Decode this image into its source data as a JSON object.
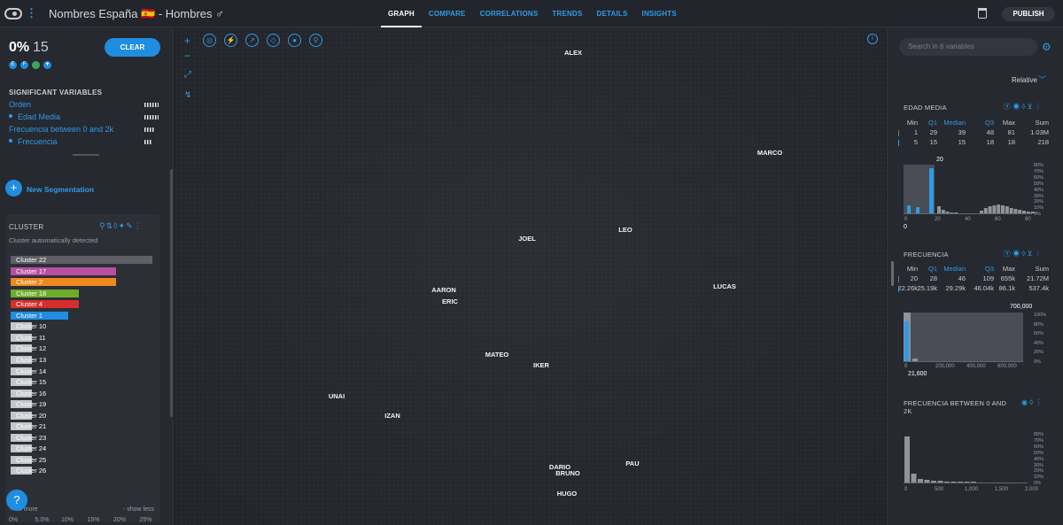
{
  "app": {
    "title": "Nombres España 🇪🇸 - Hombres ♂"
  },
  "tabs": [
    "GRAPH",
    "COMPARE",
    "CORRELATIONS",
    "TRENDS",
    "DETAILS",
    "INSIGHTS"
  ],
  "active_tab": "GRAPH",
  "publish_label": "PUBLISH",
  "selection": {
    "percent": "0%",
    "count": "15",
    "clear_label": "CLEAR"
  },
  "significant": {
    "title": "SIGNIFICANT VARIABLES",
    "items": [
      "Orden",
      "Edad Media",
      "Frecuencia between 0 and 2k",
      "Frecuencia"
    ]
  },
  "new_segmentation": "New Segmentation",
  "cluster": {
    "title": "CLUSTER",
    "subtitle": "Cluster automatically detected",
    "items": [
      {
        "label": "Cluster 22",
        "value": 27,
        "color": "#5e6065"
      },
      {
        "label": "Cluster 17",
        "value": 20,
        "color": "#b84fa0"
      },
      {
        "label": "Cluster 2",
        "value": 20,
        "color": "#f0881d"
      },
      {
        "label": "Cluster 18",
        "value": 13,
        "color": "#6fac2a"
      },
      {
        "label": "Cluster 4",
        "value": 13,
        "color": "#d62e2e"
      },
      {
        "label": "Cluster 1",
        "value": 11,
        "color": "#1f8de0"
      },
      {
        "label": "Cluster 10",
        "value": 4,
        "color": "#c4c6ca"
      },
      {
        "label": "Cluster 11",
        "value": 4,
        "color": "#c4c6ca"
      },
      {
        "label": "Cluster 12",
        "value": 4,
        "color": "#c4c6ca"
      },
      {
        "label": "Cluster 13",
        "value": 4,
        "color": "#c4c6ca"
      },
      {
        "label": "Cluster 14",
        "value": 4,
        "color": "#c4c6ca"
      },
      {
        "label": "Cluster 15",
        "value": 4,
        "color": "#c4c6ca"
      },
      {
        "label": "Cluster 16",
        "value": 4,
        "color": "#c4c6ca"
      },
      {
        "label": "Cluster 19",
        "value": 4,
        "color": "#c4c6ca"
      },
      {
        "label": "Cluster 20",
        "value": 4,
        "color": "#c4c6ca"
      },
      {
        "label": "Cluster 21",
        "value": 4,
        "color": "#c4c6ca"
      },
      {
        "label": "Cluster 23",
        "value": 4,
        "color": "#c4c6ca"
      },
      {
        "label": "Cluster 24",
        "value": 4,
        "color": "#c4c6ca"
      },
      {
        "label": "Cluster 25",
        "value": 4,
        "color": "#c4c6ca"
      },
      {
        "label": "Cluster 26",
        "value": 4,
        "color": "#c4c6ca"
      }
    ],
    "more_label": "+ 35 more",
    "less_label": "- show less",
    "axis": [
      "0%",
      "5.0%",
      "10%",
      "15%",
      "20%",
      "25%"
    ]
  },
  "graph": {
    "labels": [
      "ALEX",
      "MARCO",
      "JOEL",
      "LEO",
      "AARON",
      "ERIC",
      "LUCAS",
      "MATEO",
      "IKER",
      "UNAI",
      "IZAN",
      "DARIO",
      "BRUNO",
      "PAU",
      "HUGO"
    ]
  },
  "right": {
    "search_placeholder": "Search in 6 variables",
    "mode": "Relative",
    "edad": {
      "title": "EDAD MEDIA",
      "headers": [
        "Min",
        "Q1",
        "Median",
        "Q3",
        "Max",
        "Sum"
      ],
      "row1": [
        "1",
        "29",
        "39",
        "48",
        "81",
        "1.03M"
      ],
      "row2": [
        "5",
        "15",
        "15",
        "18",
        "18",
        "218"
      ],
      "selected_label": "20",
      "min_label": "0",
      "x_ticks": [
        "0",
        "20",
        "40",
        "60",
        "80"
      ],
      "y_ticks": [
        "80%",
        "70%",
        "60%",
        "50%",
        "40%",
        "30%",
        "20%",
        "10%",
        "0%"
      ]
    },
    "frecuencia": {
      "title": "FRECUENCIA",
      "headers": [
        "Min",
        "Q1",
        "Median",
        "Q3",
        "Max",
        "Sum"
      ],
      "row1": [
        "20",
        "28",
        "46",
        "109",
        "655k",
        "21.72M"
      ],
      "row2": [
        "22.26k",
        "25.19k",
        "29.29k",
        "46.04k",
        "86.1k",
        "537.4k"
      ],
      "max_label": "700,000",
      "min_label": "21,600",
      "x_ticks": [
        "0",
        "200,000",
        "400,000",
        "600,000"
      ],
      "y_ticks": [
        "100%",
        "80%",
        "60%",
        "40%",
        "20%",
        "0%"
      ]
    },
    "frec_range": {
      "title": "FRECUENCIA BETWEEN 0 AND 2K",
      "x_ticks": [
        "0",
        "500",
        "1,000",
        "1,500",
        "2,000"
      ],
      "y_ticks": [
        "80%",
        "70%",
        "60%",
        "50%",
        "40%",
        "30%",
        "20%",
        "10%",
        "0%"
      ]
    }
  }
}
